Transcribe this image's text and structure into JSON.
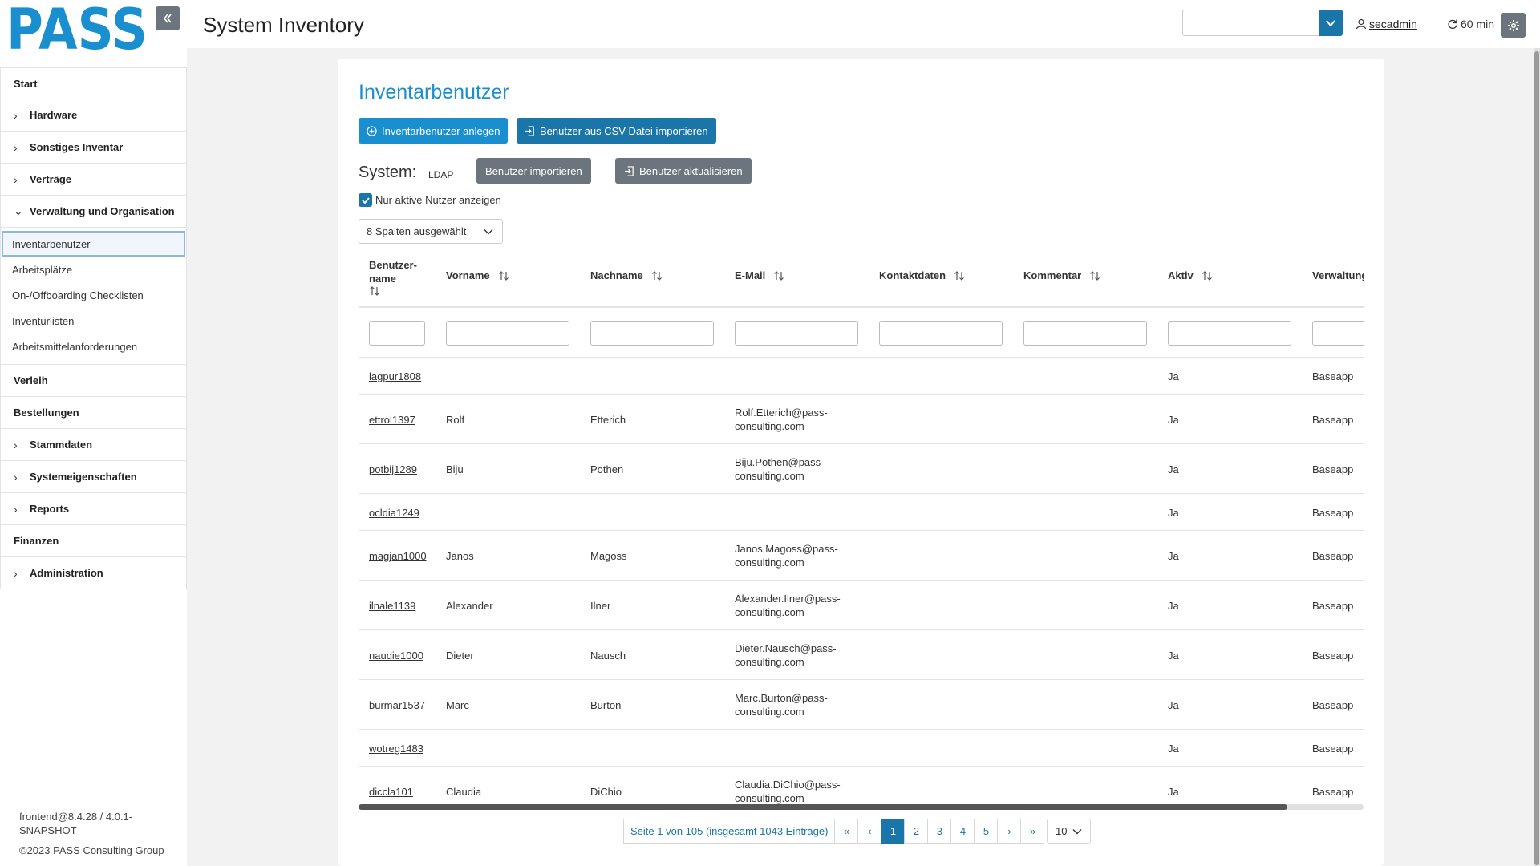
{
  "header": {
    "logo_text": "PASS",
    "title": "System Inventory",
    "system_select_value": "",
    "username": "secadmin",
    "session_timer": "60 min"
  },
  "sidebar": {
    "items": [
      {
        "label": "Start",
        "has_chevron": false
      },
      {
        "label": "Hardware",
        "has_chevron": true
      },
      {
        "label": "Sonstiges Inventar",
        "has_chevron": true
      },
      {
        "label": "Verträge",
        "has_chevron": true
      },
      {
        "label": "Verwaltung und Organisation",
        "has_chevron": true,
        "expanded": true
      }
    ],
    "subitems": [
      {
        "label": "Inventarbenutzer",
        "active": true
      },
      {
        "label": "Arbeitsplätze"
      },
      {
        "label": "On-/Offboarding Checklisten"
      },
      {
        "label": "Inventurlisten"
      },
      {
        "label": "Arbeitsmittelanforderungen"
      }
    ],
    "items_after": [
      {
        "label": "Verleih",
        "has_chevron": false
      },
      {
        "label": "Bestellungen",
        "has_chevron": false
      },
      {
        "label": "Stammdaten",
        "has_chevron": true
      },
      {
        "label": "Systemeigenschaften",
        "has_chevron": true
      },
      {
        "label": "Reports",
        "has_chevron": true
      },
      {
        "label": "Finanzen",
        "has_chevron": false
      },
      {
        "label": "Administration",
        "has_chevron": true
      }
    ],
    "footer_version": "frontend@8.4.28 / 4.0.1-SNAPSHOT",
    "footer_copyright": "©2023 PASS Consulting Group"
  },
  "page": {
    "title": "Inventarbenutzer",
    "btn_create": "Inventarbenutzer anlegen",
    "btn_import_csv": "Benutzer aus CSV-Datei importieren",
    "system_label": "System:",
    "system_value": "LDAP",
    "btn_import_users": "Benutzer importieren",
    "btn_update_users": "Benutzer aktualisieren",
    "checkbox_label": "Nur aktive Nutzer anzeigen",
    "checkbox_checked": true,
    "columns_select": "8 Spalten ausgewählt"
  },
  "table": {
    "columns": [
      "Benutzer-name",
      "Vorname",
      "Nachname",
      "E-Mail",
      "Kontaktdaten",
      "Kommentar",
      "Aktiv",
      "Verwaltung"
    ],
    "rows": [
      {
        "username": "lagpur1808",
        "vorname": "",
        "nachname": "",
        "email1": "",
        "email2": "",
        "kontakt": "",
        "kommentar": "",
        "aktiv": "Ja",
        "verwaltung": "Baseapp"
      },
      {
        "username": "ettrol1397",
        "vorname": "Rolf",
        "nachname": "Etterich",
        "email1": "Rolf.Etterich@pass-",
        "email2": "consulting.com",
        "kontakt": "",
        "kommentar": "",
        "aktiv": "Ja",
        "verwaltung": "Baseapp"
      },
      {
        "username": "potbij1289",
        "vorname": "Biju",
        "nachname": "Pothen",
        "email1": "Biju.Pothen@pass-",
        "email2": "consulting.com",
        "kontakt": "",
        "kommentar": "",
        "aktiv": "Ja",
        "verwaltung": "Baseapp"
      },
      {
        "username": "ocldia1249",
        "vorname": "",
        "nachname": "",
        "email1": "",
        "email2": "",
        "kontakt": "",
        "kommentar": "",
        "aktiv": "Ja",
        "verwaltung": "Baseapp"
      },
      {
        "username": "magjan1000",
        "vorname": "Janos",
        "nachname": "Magoss",
        "email1": "Janos.Magoss@pass-",
        "email2": "consulting.com",
        "kontakt": "",
        "kommentar": "",
        "aktiv": "Ja",
        "verwaltung": "Baseapp"
      },
      {
        "username": "ilnale1139",
        "vorname": "Alexander",
        "nachname": "Ilner",
        "email1": "Alexander.Ilner@pass-",
        "email2": "consulting.com",
        "kontakt": "",
        "kommentar": "",
        "aktiv": "Ja",
        "verwaltung": "Baseapp"
      },
      {
        "username": "naudie1000",
        "vorname": "Dieter",
        "nachname": "Nausch",
        "email1": "Dieter.Nausch@pass-",
        "email2": "consulting.com",
        "kontakt": "",
        "kommentar": "",
        "aktiv": "Ja",
        "verwaltung": "Baseapp"
      },
      {
        "username": "burmar1537",
        "vorname": "Marc",
        "nachname": "Burton",
        "email1": "Marc.Burton@pass-",
        "email2": "consulting.com",
        "kontakt": "",
        "kommentar": "",
        "aktiv": "Ja",
        "verwaltung": "Baseapp"
      },
      {
        "username": "wotreg1483",
        "vorname": "",
        "nachname": "",
        "email1": "",
        "email2": "",
        "kontakt": "",
        "kommentar": "",
        "aktiv": "Ja",
        "verwaltung": "Baseapp"
      },
      {
        "username": "diccla101",
        "vorname": "Claudia",
        "nachname": "DiChio",
        "email1": "Claudia.DiChio@pass-",
        "email2": "consulting.com",
        "kontakt": "",
        "kommentar": "",
        "aktiv": "Ja",
        "verwaltung": "Baseapp"
      }
    ]
  },
  "pagination": {
    "info": "Seite 1 von 105 (insgesamt 1043 Einträge)",
    "first": "«",
    "prev": "‹",
    "pages": [
      "1",
      "2",
      "3",
      "4",
      "5"
    ],
    "active_page": "1",
    "next": "›",
    "last": "»",
    "page_size": "10"
  },
  "colors": {
    "primary": "#1a8fd0",
    "primary_dark": "#1a75a8",
    "secondary": "#6c757d",
    "background": "#f2f2f2"
  }
}
